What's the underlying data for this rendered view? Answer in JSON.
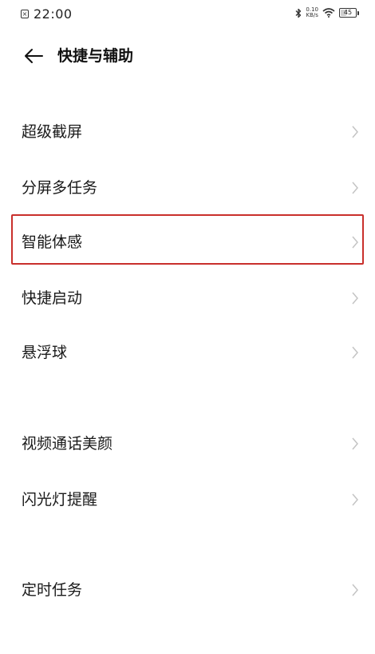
{
  "status_bar": {
    "time": "22:00",
    "net_speed_value": "0.10",
    "net_speed_unit": "KB/s",
    "battery_level": "45"
  },
  "header": {
    "title": "快捷与辅助"
  },
  "settings": {
    "items": [
      {
        "label": "超级截屏"
      },
      {
        "label": "分屏多任务"
      },
      {
        "label": "智能体感"
      },
      {
        "label": "快捷启动"
      },
      {
        "label": "悬浮球"
      },
      {
        "label": "视频通话美颜"
      },
      {
        "label": "闪光灯提醒"
      },
      {
        "label": "定时任务"
      }
    ]
  },
  "highlight": {
    "item_label": "智能体感",
    "border_color": "#c9302c"
  },
  "icons": {
    "back": "back-arrow-icon",
    "chevron": "chevron-right-icon",
    "bluetooth": "bluetooth-icon",
    "wifi": "wifi-icon",
    "battery": "battery-icon",
    "notification": "notification-icon"
  }
}
